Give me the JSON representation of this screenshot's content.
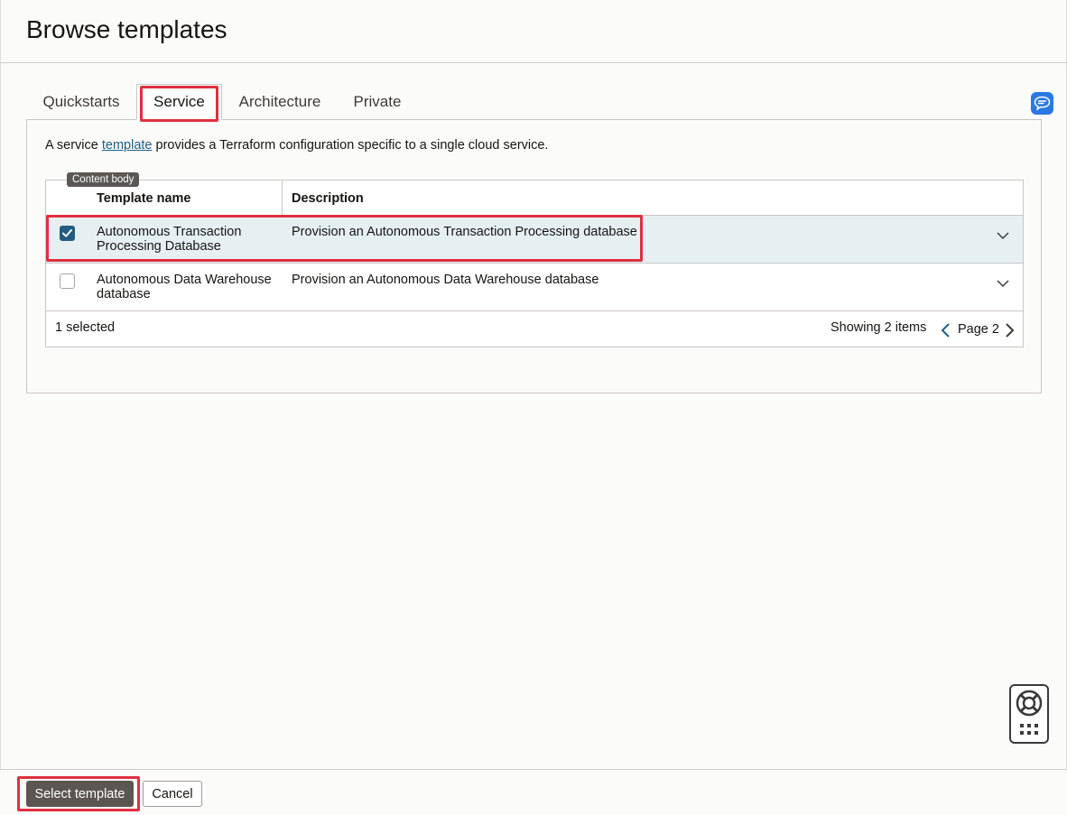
{
  "header": {
    "title": "Browse templates"
  },
  "tabs": [
    {
      "label": "Quickstarts"
    },
    {
      "label": "Service"
    },
    {
      "label": "Architecture"
    },
    {
      "label": "Private"
    }
  ],
  "active_tab": "Service",
  "intro": {
    "before": "A service ",
    "link": "template",
    "after": " provides a Terraform configuration specific to a single cloud service."
  },
  "tooltip": "Content body",
  "table": {
    "columns": [
      "Template name",
      "Description"
    ],
    "rows": [
      {
        "name": "Autonomous Transaction Processing Database",
        "description": "Provision an Autonomous Transaction Processing database",
        "selected": true
      },
      {
        "name": "Autonomous Data Warehouse database",
        "description": "Provision an Autonomous Data Warehouse database",
        "selected": false
      }
    ],
    "footer": {
      "selected_count": "1 selected",
      "showing": "Showing 2 items",
      "page": "Page 2"
    }
  },
  "footer": {
    "select_label": "Select template",
    "cancel_label": "Cancel"
  },
  "colors": {
    "highlight": "#e0303f",
    "selected_row": "#e6f0f3",
    "checkbox": "#235c82",
    "link": "#1e5f88",
    "primary_button": "#5b5651",
    "assistant_icon": "#2a78e4"
  },
  "icons": {
    "assistant": "chat-assistant-icon",
    "expand": "chevron-down-icon",
    "prev": "chevron-left-icon",
    "next": "chevron-right-icon",
    "help": "lifebuoy-icon",
    "apps": "grid-dots-icon"
  }
}
